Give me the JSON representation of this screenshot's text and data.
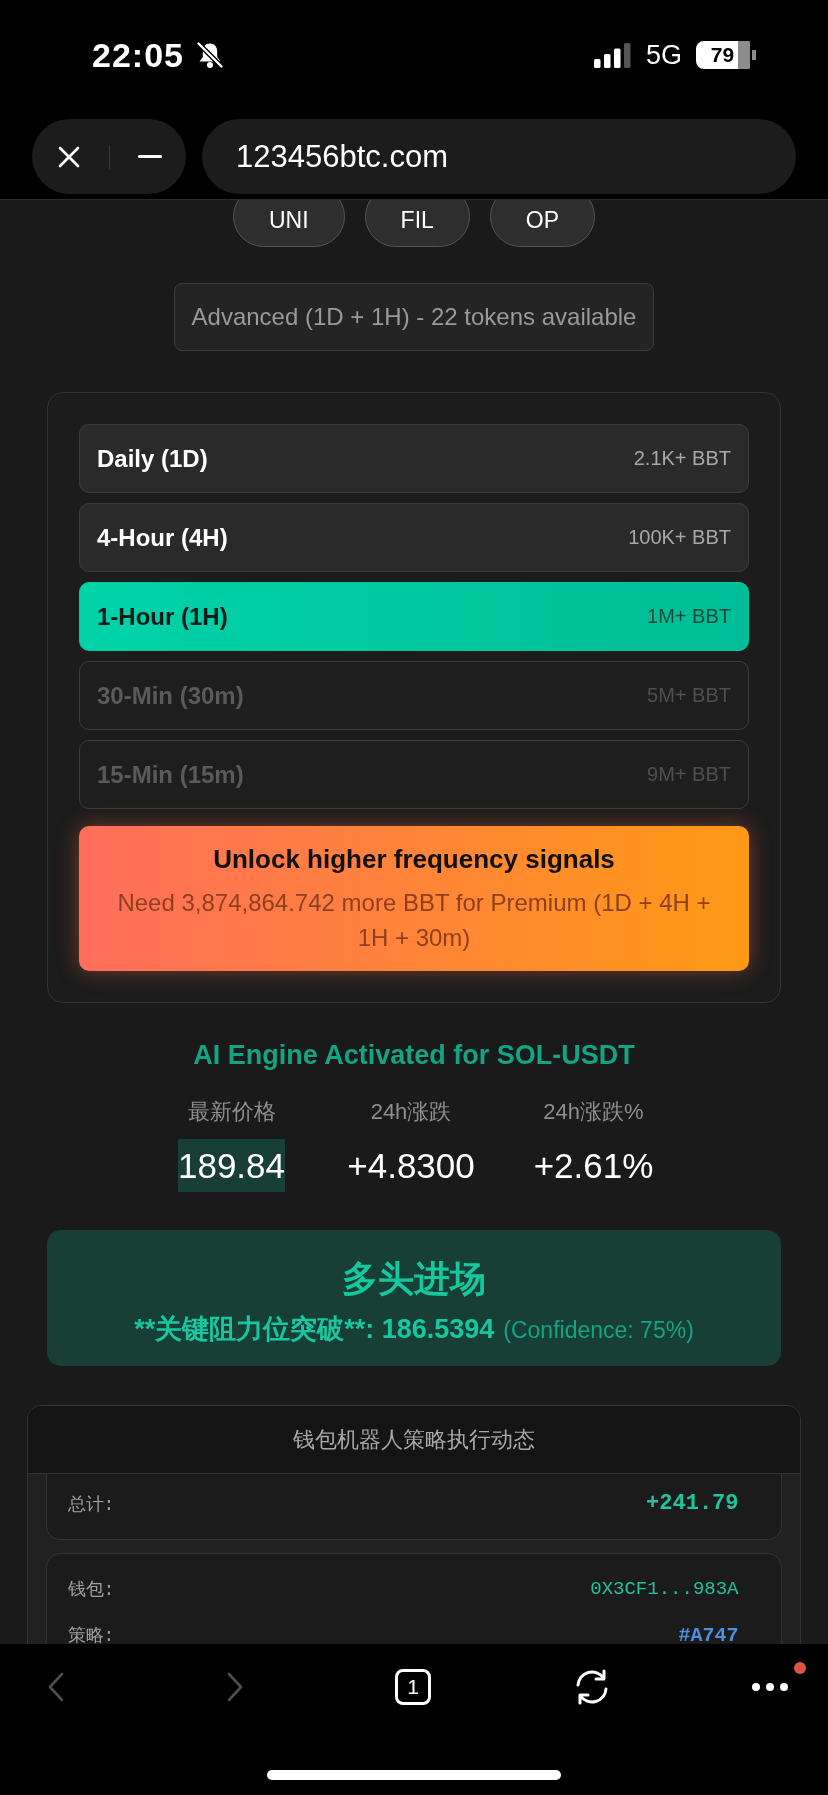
{
  "status_bar": {
    "time": "22:05",
    "silent": true,
    "network": "5G",
    "battery": "79"
  },
  "browser": {
    "url": "123456btc.com"
  },
  "tokens": [
    {
      "symbol": "UNI"
    },
    {
      "symbol": "FIL"
    },
    {
      "symbol": "OP"
    }
  ],
  "tier_notice": "Advanced (1D + 1H) - 22 tokens available",
  "timeframes": [
    {
      "label": "Daily (1D)",
      "requirement": "2.1K+ BBT",
      "selected": false,
      "locked": false
    },
    {
      "label": "4-Hour (4H)",
      "requirement": "100K+ BBT",
      "selected": false,
      "locked": false
    },
    {
      "label": "1-Hour (1H)",
      "requirement": "1M+ BBT",
      "selected": true,
      "locked": false
    },
    {
      "label": "30-Min (30m)",
      "requirement": "5M+ BBT",
      "selected": false,
      "locked": true
    },
    {
      "label": "15-Min (15m)",
      "requirement": "9M+ BBT",
      "selected": false,
      "locked": true
    }
  ],
  "unlock_banner": {
    "title": "Unlock higher frequency signals",
    "message": "Need 3,874,864.742 more BBT for Premium (1D + 4H + 1H + 30m)"
  },
  "engine": {
    "title": "AI Engine Activated for SOL-USDT",
    "stats": [
      {
        "label": "最新价格",
        "value": "189.84",
        "highlighted": true
      },
      {
        "label": "24h涨跌",
        "value": "+4.8300",
        "highlighted": false
      },
      {
        "label": "24h涨跌%",
        "value": "+2.61%",
        "highlighted": false
      }
    ]
  },
  "signal": {
    "title": "多头进场",
    "detail": "**关键阻力位突破**: 186.5394",
    "confidence": "(Confidence: 75%)"
  },
  "wallet_feed": {
    "title": "钱包机器人策略执行动态",
    "cards": [
      {
        "rows": [
          {
            "kind": "total",
            "label": "总计:",
            "value": "+241.79"
          }
        ]
      },
      {
        "rows": [
          {
            "kind": "address",
            "label": "钱包:",
            "value": "0X3CF1...983A"
          },
          {
            "kind": "strategy",
            "label": "策略:",
            "value": "#A747"
          }
        ]
      }
    ]
  },
  "toolbar": [
    {
      "kind": "back",
      "disabled": true
    },
    {
      "kind": "forward",
      "disabled": true
    },
    {
      "kind": "tabs",
      "count": "1"
    },
    {
      "kind": "reload"
    },
    {
      "kind": "more",
      "notification": true
    }
  ]
}
